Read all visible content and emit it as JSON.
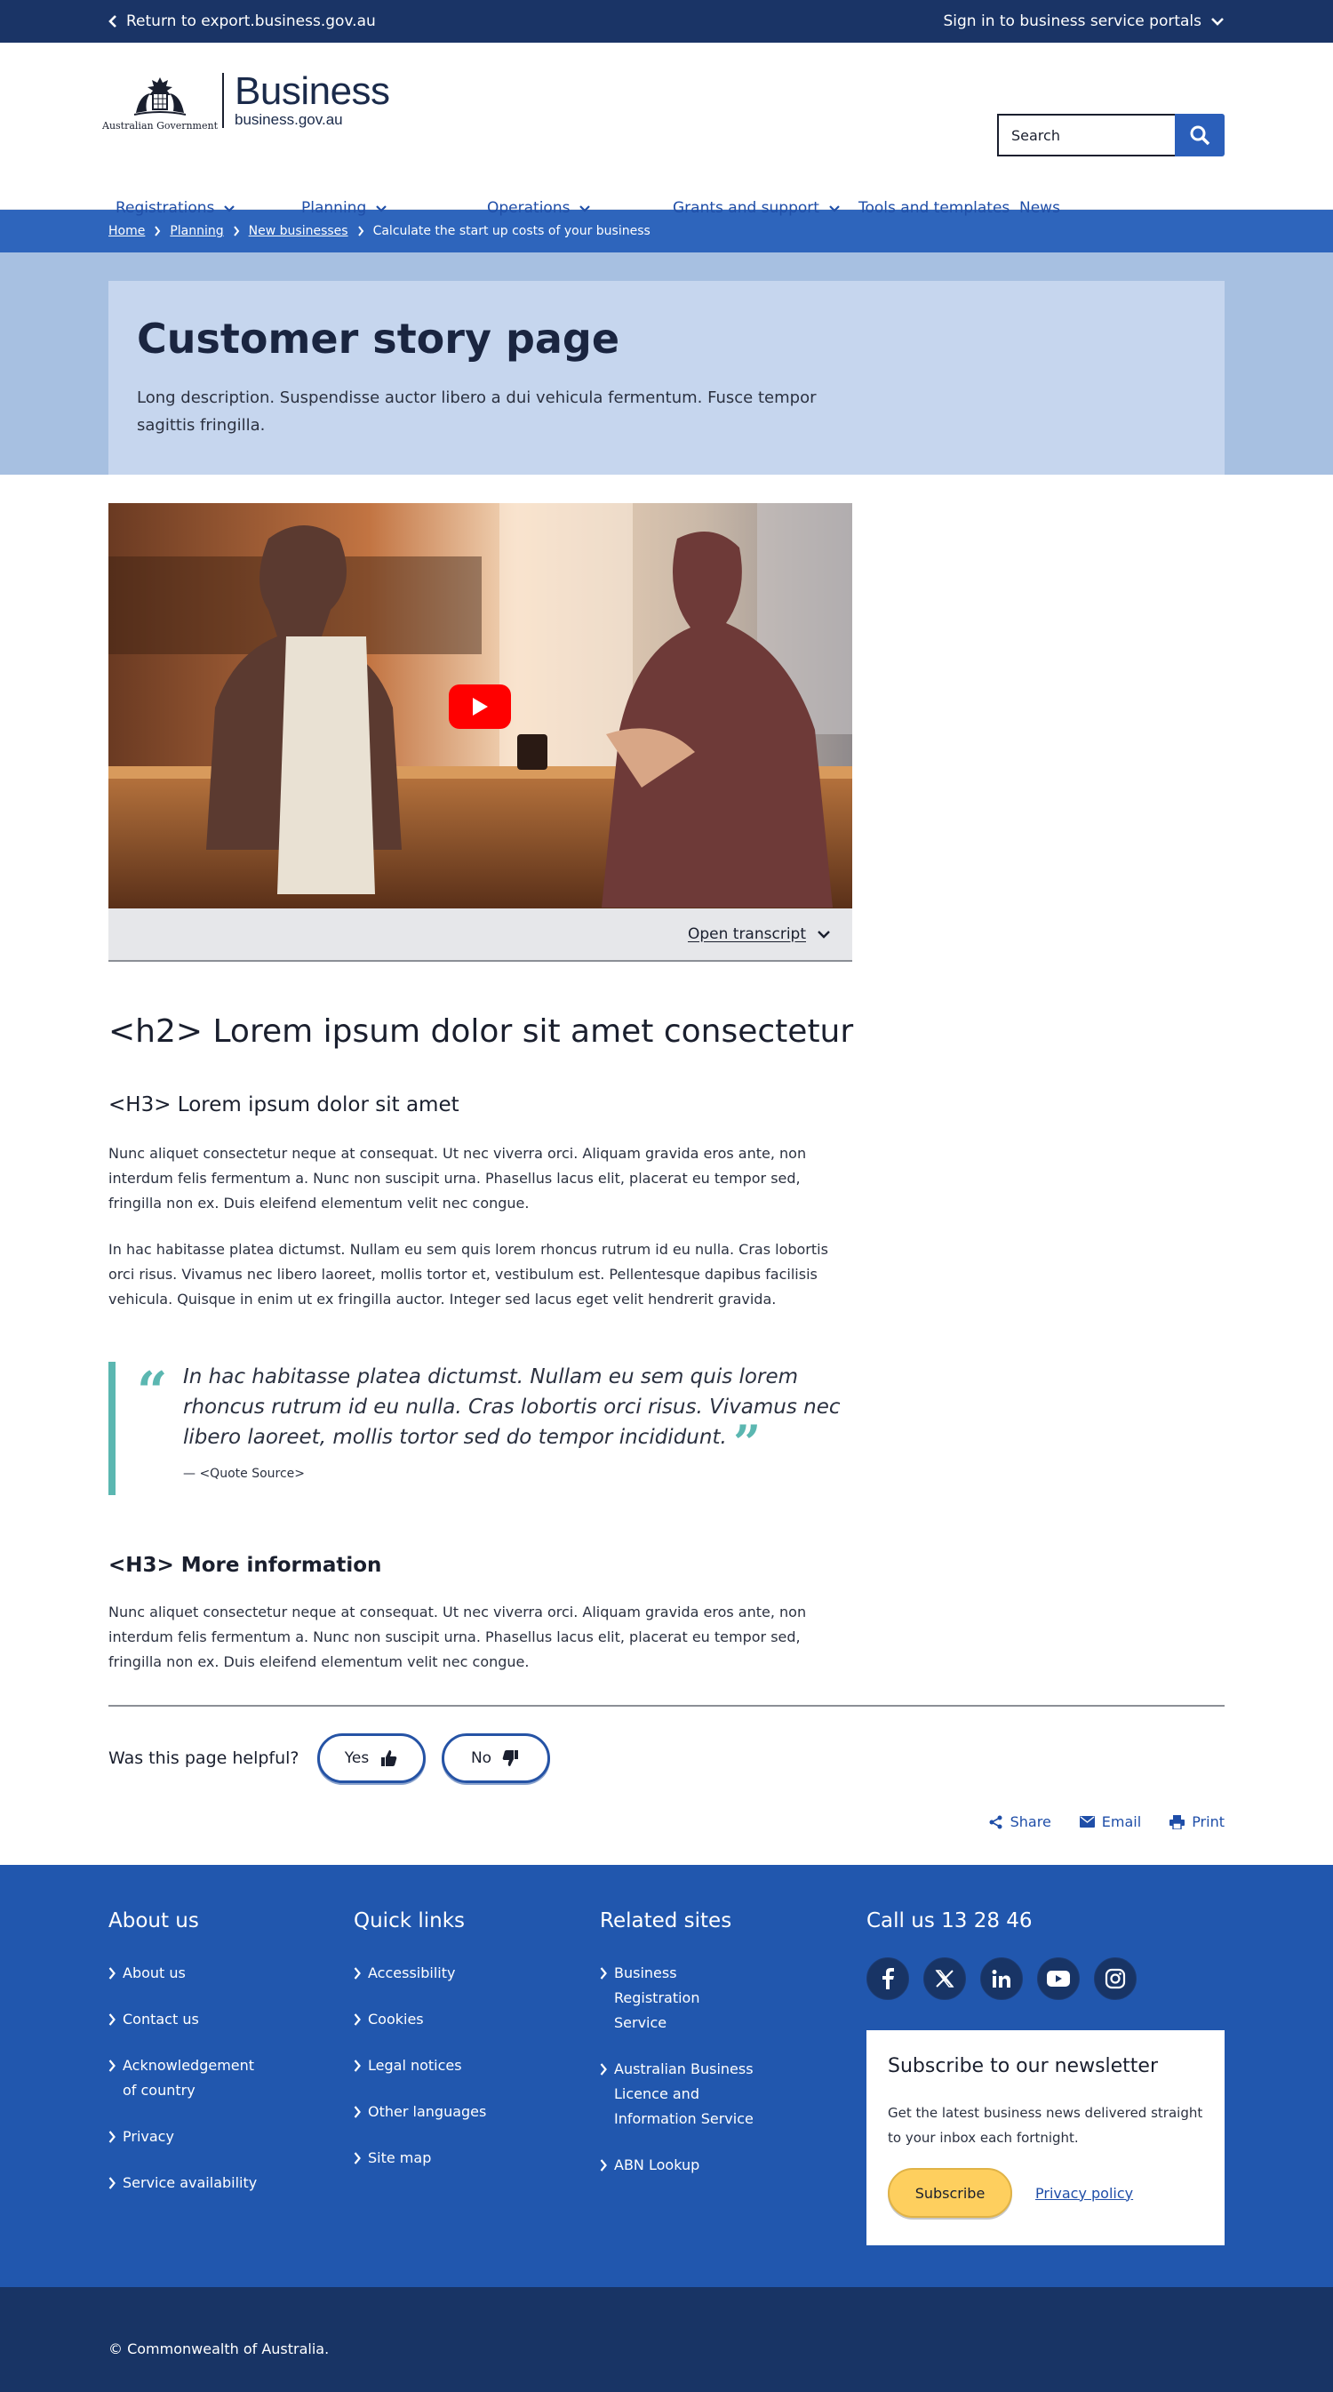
{
  "topbar": {
    "return_label": "Return to export.business.gov.au",
    "signin_label": "Sign in to business service portals"
  },
  "header": {
    "govt_label": "Australian Government",
    "brand_title": "Business",
    "brand_url": "business.gov.au",
    "search_placeholder": "Search"
  },
  "nav": [
    {
      "label": "Registrations",
      "dropdown": true
    },
    {
      "label": "Planning",
      "dropdown": true
    },
    {
      "label": "Operations",
      "dropdown": true
    },
    {
      "label": "Grants and support",
      "dropdown": true
    },
    {
      "label": "Tools and templates",
      "dropdown": false
    },
    {
      "label": "News",
      "dropdown": false
    }
  ],
  "breadcrumb": {
    "home": "Home",
    "planning": "Planning",
    "new_businesses": "New businesses",
    "current": "Calculate the start up costs of your business"
  },
  "hero": {
    "title": "Customer story page",
    "description": "Long description. Suspendisse auctor libero a dui vehicula fermentum. Fusce tempor sagittis fringilla."
  },
  "video": {
    "transcript_label": "Open transcript"
  },
  "content": {
    "h2": "<h2> Lorem ipsum dolor sit amet consectetur",
    "h3_1": "<H3> Lorem ipsum dolor sit amet",
    "p1": "Nunc aliquet consectetur neque at consequat. Ut nec viverra orci. Aliquam gravida eros ante, non interdum felis fermentum a. Nunc non suscipit urna. Phasellus lacus elit, placerat eu tempor sed, fringilla non ex. Duis eleifend elementum velit nec congue.",
    "p2": "In hac habitasse platea dictumst. Nullam eu sem quis lorem rhoncus rutrum id eu nulla. Cras lobortis orci risus. Vivamus nec libero laoreet, mollis tortor et, vestibulum est. Pellentesque dapibus facilisis vehicula. Quisque in enim ut ex fringilla auctor. Integer sed lacus eget velit hendrerit gravida.",
    "quote_text": "In hac habitasse platea dictumst. Nullam eu sem quis lorem rhoncus rutrum id eu nulla. Cras lobortis orci risus. Vivamus nec libero laoreet, mollis tortor sed do tempor incididunt.",
    "quote_source": "— <Quote Source>",
    "h3_2": "<H3> More information",
    "p3": "Nunc aliquet consectetur neque at consequat. Ut nec viverra orci. Aliquam gravida eros ante, non interdum felis fermentum a. Nunc non suscipit urna. Phasellus lacus elit, placerat eu tempor sed, fringilla non ex. Duis eleifend elementum velit nec congue."
  },
  "feedback": {
    "question": "Was this page helpful?",
    "yes": "Yes",
    "no": "No"
  },
  "share": {
    "share": "Share",
    "email": "Email",
    "print": "Print"
  },
  "footer": {
    "about": {
      "heading": "About us",
      "items": [
        "About us",
        "Contact us",
        "Acknowledgement of country",
        "Privacy",
        "Service availability"
      ]
    },
    "quick": {
      "heading": "Quick links",
      "items": [
        "Accessibility",
        "Cookies",
        "Legal notices",
        "Other languages",
        "Site map"
      ]
    },
    "related": {
      "heading": "Related sites",
      "items": [
        "Business Registration Service",
        "Australian Business Licence and Information Service",
        "ABN Lookup"
      ]
    },
    "call": "Call us 13 28 46",
    "social_icons": [
      "facebook-icon",
      "x-icon",
      "linkedin-icon",
      "youtube-icon",
      "instagram-icon"
    ],
    "newsletter": {
      "heading": "Subscribe to our newsletter",
      "text": "Get the latest business news delivered straight to your inbox each fortnight.",
      "button": "Subscribe",
      "privacy": "Privacy policy"
    },
    "copyright": "© Commonwealth of Australia."
  },
  "colors": {
    "navy": "#1a3466",
    "blue": "#2e65bc",
    "link": "#1f4ea8",
    "hero": "#a7c0e1",
    "hero_card": "#c6d6ee",
    "teal": "#5bb7b1",
    "yellow": "#fecf5e",
    "footer": "#2157ae"
  }
}
